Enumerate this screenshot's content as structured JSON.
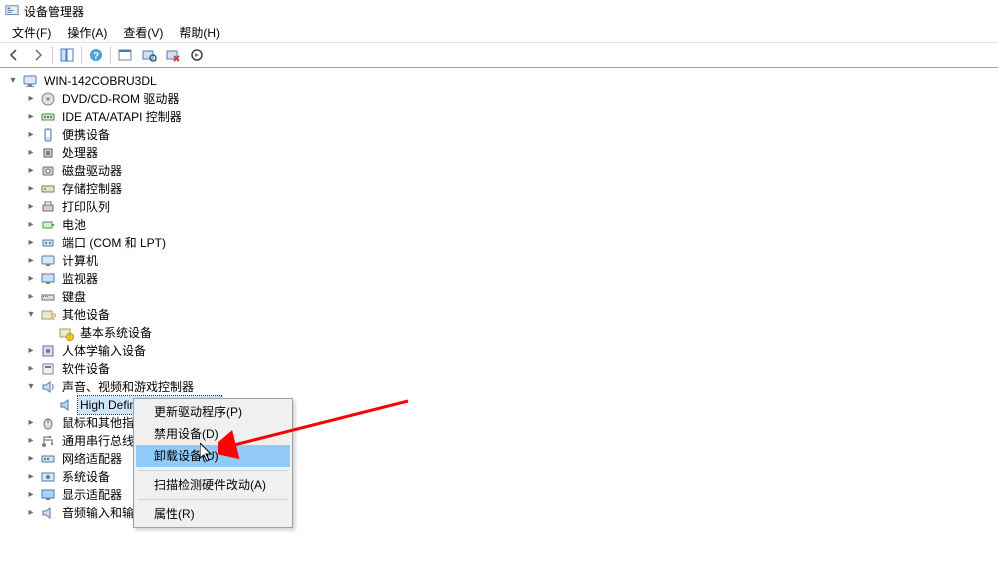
{
  "window": {
    "title": "设备管理器"
  },
  "menu": {
    "file": "文件(F)",
    "action": "操作(A)",
    "view": "查看(V)",
    "help": "帮助(H)"
  },
  "tree": {
    "root": "WIN-142COBRU3DL",
    "items": [
      {
        "label": "DVD/CD-ROM 驱动器",
        "icon": "disc"
      },
      {
        "label": "IDE ATA/ATAPI 控制器",
        "icon": "ide"
      },
      {
        "label": "便携设备",
        "icon": "portable"
      },
      {
        "label": "处理器",
        "icon": "cpu"
      },
      {
        "label": "磁盘驱动器",
        "icon": "disk"
      },
      {
        "label": "存储控制器",
        "icon": "storage"
      },
      {
        "label": "打印队列",
        "icon": "printer"
      },
      {
        "label": "电池",
        "icon": "battery"
      },
      {
        "label": "端口 (COM 和 LPT)",
        "icon": "port"
      },
      {
        "label": "计算机",
        "icon": "computer"
      },
      {
        "label": "监视器",
        "icon": "monitor"
      },
      {
        "label": "键盘",
        "icon": "keyboard"
      },
      {
        "label": "其他设备",
        "icon": "other",
        "expanded": true,
        "children": [
          {
            "label": "基本系统设备",
            "icon": "unknown"
          }
        ]
      },
      {
        "label": "人体学输入设备",
        "icon": "hid"
      },
      {
        "label": "软件设备",
        "icon": "software"
      },
      {
        "label": "声音、视频和游戏控制器",
        "icon": "sound",
        "expanded": true,
        "children": [
          {
            "label": "High Definition Audio 设备",
            "icon": "speaker",
            "selected": true
          }
        ]
      },
      {
        "label": "鼠标和其他指",
        "icon": "mouse",
        "truncated": true
      },
      {
        "label": "通用串行总线",
        "icon": "usb",
        "truncated": true
      },
      {
        "label": "网络适配器",
        "icon": "network"
      },
      {
        "label": "系统设备",
        "icon": "system"
      },
      {
        "label": "显示适配器",
        "icon": "display"
      },
      {
        "label": "音频输入和输",
        "icon": "audio",
        "truncated": true
      }
    ]
  },
  "context_menu": {
    "update": "更新驱动程序(P)",
    "disable": "禁用设备(D)",
    "uninstall": "卸载设备(U)",
    "scan": "扫描检测硬件改动(A)",
    "props": "属性(R)"
  }
}
